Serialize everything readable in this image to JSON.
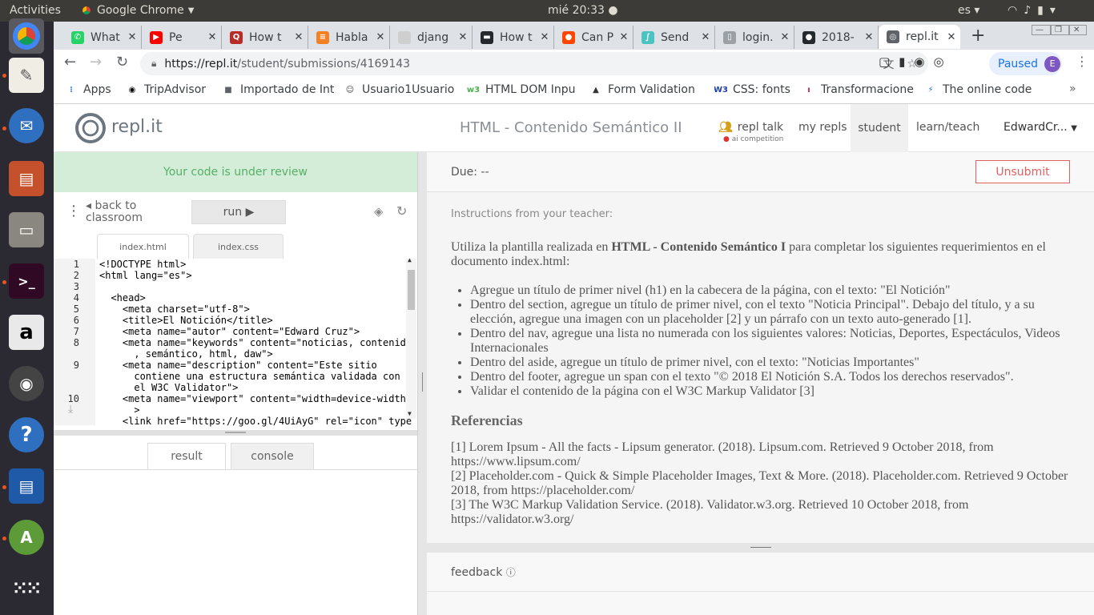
{
  "os": {
    "activities": "Activities",
    "app_name": "Google Chrome",
    "clock": "mié 20:33",
    "language": "es"
  },
  "tabs": [
    {
      "label": "What",
      "fav_color": "#25d366",
      "fav_glyph": "✆"
    },
    {
      "label": "Pe",
      "fav_color": "#ff0000",
      "fav_glyph": "▶"
    },
    {
      "label": "How t",
      "fav_color": "#b92b27",
      "fav_glyph": "Q"
    },
    {
      "label": "Habla",
      "fav_color": "#f48024",
      "fav_glyph": "≡"
    },
    {
      "label": "djang",
      "fav_color": "#cfcfcf",
      "fav_glyph": ""
    },
    {
      "label": "How t",
      "fav_color": "#24292e",
      "fav_glyph": "▬"
    },
    {
      "label": "Can P",
      "fav_color": "#ff4500",
      "fav_glyph": "●"
    },
    {
      "label": "Send",
      "fav_color": "#4cc3c3",
      "fav_glyph": "∫"
    },
    {
      "label": "login.",
      "fav_color": "#9aa0a6",
      "fav_glyph": "▯"
    },
    {
      "label": "2018-",
      "fav_color": "#24292e",
      "fav_glyph": "●"
    },
    {
      "label": "repl.it",
      "fav_color": "#5f6368",
      "fav_glyph": "◎"
    }
  ],
  "browser": {
    "url_host": "https://repl.it",
    "url_path": "/student/submissions/4169143",
    "paused_label": "Paused",
    "profile_initial": "E"
  },
  "bookmarks": [
    {
      "label": "Apps",
      "icon_color": "#4285f4",
      "glyph": "⁝"
    },
    {
      "label": "TripAdvisor",
      "icon_color": "#000000",
      "glyph": "◉"
    },
    {
      "label": "Importado de Int",
      "icon_color": "#5f6368",
      "glyph": "■"
    },
    {
      "label": "Usuario1Usuario",
      "icon_color": "#3c4043",
      "glyph": "☺"
    },
    {
      "label": "HTML DOM Inpu",
      "icon_color": "#4caf50",
      "glyph": "w3"
    },
    {
      "label": "Form Validation",
      "icon_color": "#333333",
      "glyph": "▲"
    },
    {
      "label": "CSS: fonts",
      "icon_color": "#1e40af",
      "glyph": "W3"
    },
    {
      "label": "Transformacione",
      "icon_color": "#c2185b",
      "glyph": "ı"
    },
    {
      "label": "The online code",
      "icon_color": "#1a73e8",
      "glyph": "⚡"
    }
  ],
  "header": {
    "logo_text": "repl.it",
    "page_title": "HTML - Contenido Semántico II",
    "nav_talk": "repl talk",
    "nav_talk_sub": "ai competition",
    "nav_myrepls": "my repls",
    "nav_student": "student",
    "nav_learn": "learn/teach",
    "user_name": "EdwardCr..."
  },
  "left": {
    "review_status": "Your code is under review",
    "back_label": "back to classroom",
    "run_label": "run",
    "file_tabs": [
      "index.html",
      "index.css"
    ],
    "result_tab": "result",
    "console_tab": "console"
  },
  "right": {
    "due": "Due: --",
    "unsubmit": "Unsubmit",
    "instructions_label": "Instructions from your teacher:",
    "feedback": "feedback"
  },
  "instructions": {
    "intro_pre": "Utiliza la plantilla realizada en ",
    "intro_bold": "HTML - Contenido Semántico I",
    "intro_post": " para completar los siguientes requerimientos en el documento index.html:",
    "items": [
      "Agregue un título de primer nivel (h1) en la cabecera de la página, con el texto: \"El Notición\"",
      "Dentro del section, agregue un título de primer nivel, con el texto \"Noticia Principal\". Debajo del título, y a su elección, agregue una imagen con un placeholder [2] y un párrafo con un texto auto-generado [1].",
      "Dentro del nav, agregue una lista no numerada con los siguientes valores: Noticias, Deportes, Espectáculos, Videos Internacionales",
      "Dentro del aside, agregue un título de primer nivel, con el texto: \"Noticias Importantes\"",
      "Dentro del footer, agregue un span con el texto \"© 2018 El Notición S.A. Todos los derechos reservados\".",
      "Validar el contenido de la página con el W3C Markup Validator [3]"
    ],
    "references_title": "Referencias",
    "references": [
      "[1] Lorem Ipsum - All the facts - Lipsum generator. (2018). Lipsum.com. Retrieved 9 October 2018, from https://www.lipsum.com/",
      "[2] Placeholder.com - Quick & Simple Placeholder Images, Text & More. (2018). Placeholder.com. Retrieved 9 October 2018, from https://placeholder.com/",
      "[3]  The W3C Markup Validation Service. (2018). Validator.w3.org. Retrieved 10 October 2018, from https://validator.w3.org/"
    ]
  },
  "code": {
    "line_numbers": [
      "1",
      "2",
      "3",
      "4",
      "5",
      "6",
      "7",
      "8",
      "9",
      "10"
    ],
    "lines": [
      "<!DOCTYPE html>",
      "<html lang=\"es\">",
      "",
      "  <head>",
      "    <meta charset=\"utf-8\">",
      "    <title>El Notición</title>",
      "    <meta name=\"autor\" content=\"Edward Cruz\">",
      "    <meta name=\"keywords\" content=\"noticias, contenido",
      "      , semántico, html, daw\">",
      "    <meta name=\"description\" content=\"Este sitio",
      "      contiene una estructura semántica validada con",
      "      el W3C Validator\">",
      "    <meta name=\"viewport\" content=\"width=device-width\"",
      "      >",
      "    <link href=\"https://goo.gl/4UiAyG\" rel=\"icon\" type"
    ]
  }
}
